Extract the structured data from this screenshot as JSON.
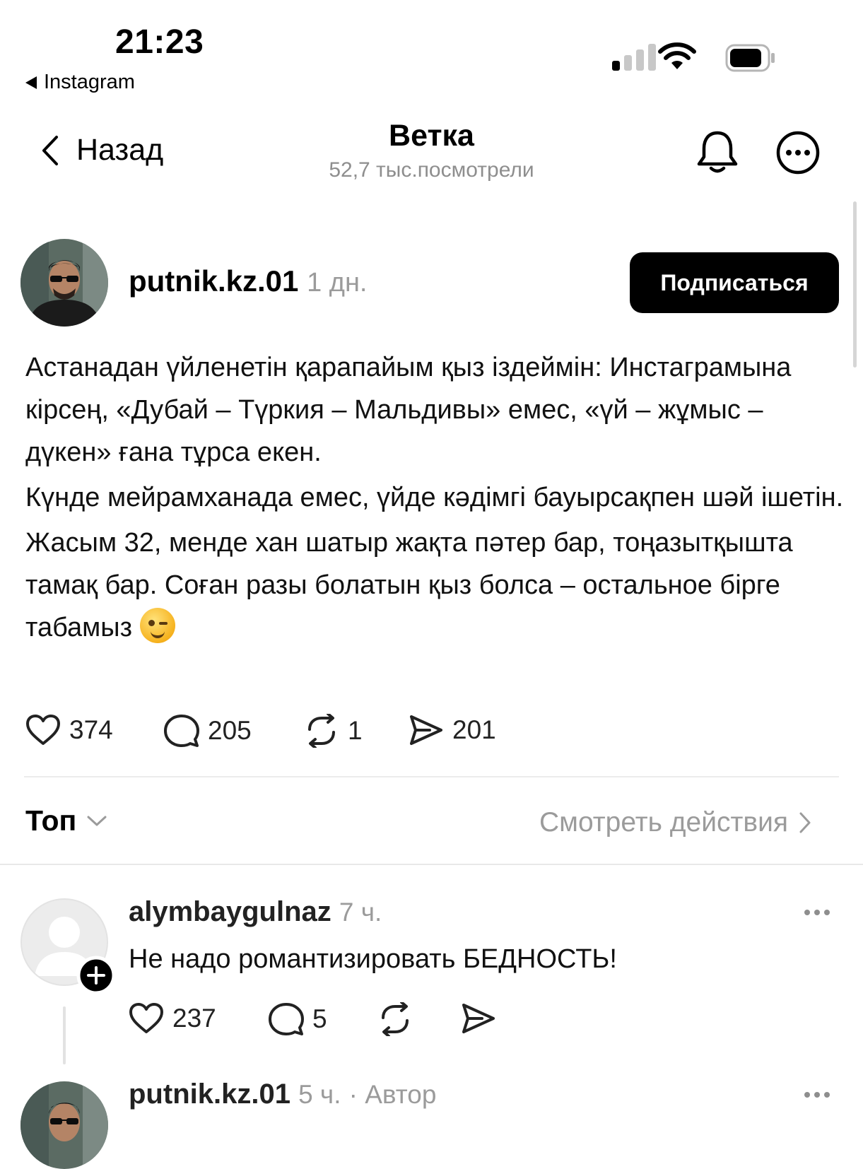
{
  "status_bar": {
    "time": "21:23",
    "back_app": "Instagram"
  },
  "nav": {
    "back_label": "Назад",
    "title": "Ветка",
    "subtitle": "52,7 тыс.посмотрели"
  },
  "post": {
    "username": "putnik.kz.01",
    "time": "1 дн.",
    "follow_label": "Подписаться",
    "paragraphs": [
      "Астанадан үйленетін қарапайым қыз іздеймін: Инстаграмына кірсең, «Дубай – Түркия – Мальдивы» емес, «үй – жұмыс – дүкен» ғана тұрса екен.",
      "Күнде мейрамханада емес, үйде кәдімгі бауырсақпен шәй ішетін.",
      "Жасым 32, менде хан шатыр жақта пәтер бар, тоңазытқышта тамақ бар. Соған разы болатын қыз болса – остальное бірге табамыз"
    ],
    "likes": "374",
    "comments": "205",
    "reposts": "1",
    "shares": "201"
  },
  "sort": {
    "label": "Топ",
    "view_activity": "Смотреть действия"
  },
  "comments": [
    {
      "username": "alymbaygulnaz",
      "time": "7 ч.",
      "text": "Не надо романтизировать БЕДНОСТЬ!",
      "likes": "237",
      "replies": "5"
    },
    {
      "username": "putnik.kz.01",
      "time": "5 ч.",
      "author_tag": "· Автор"
    }
  ],
  "icons": [
    "chevron-left-icon",
    "bell-icon",
    "more-icon",
    "heart-icon",
    "comment-icon",
    "repost-icon",
    "share-icon",
    "chevron-down-icon",
    "chevron-right-icon",
    "add-follow-icon"
  ]
}
